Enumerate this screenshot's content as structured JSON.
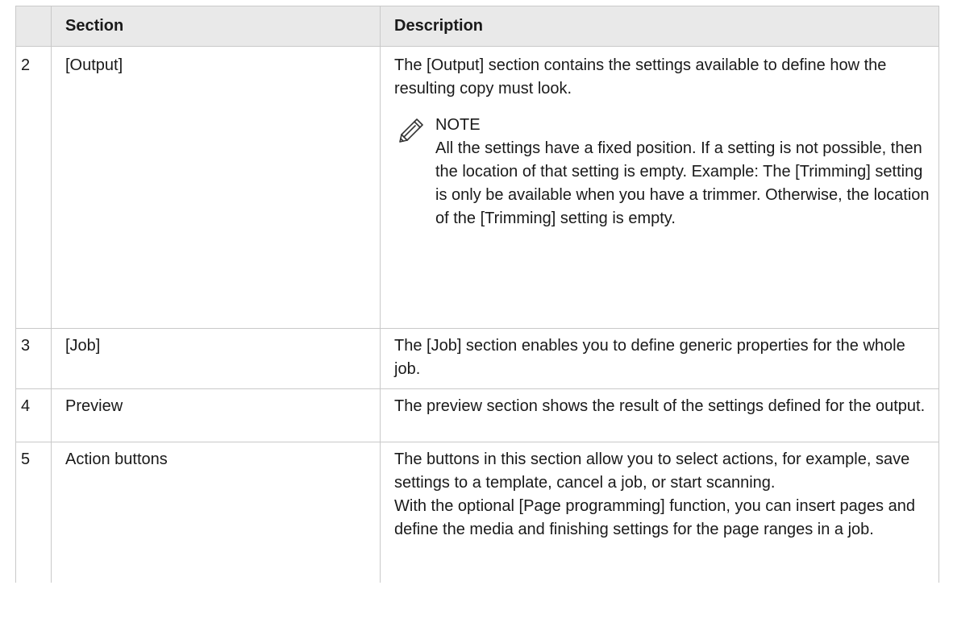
{
  "table": {
    "headers": {
      "number": "",
      "section": "Section",
      "description": "Description"
    },
    "rows": [
      {
        "number": "2",
        "section": "[Output]",
        "description": "The [Output] section contains the settings available to define how the resulting copy must look.",
        "note": {
          "icon": "pencil-icon",
          "title": "NOTE",
          "text": "All the settings have a fixed position. If a set­ting is not possible, then the location of that setting is empty. Example: The [Trimming] set­ting is only be available when you have a trim­mer. Otherwise, the location of the [Trimming] setting is empty."
        }
      },
      {
        "number": "3",
        "section": "[Job]",
        "description": "The [Job] section enables you to define generic proper­ties for the whole job."
      },
      {
        "number": "4",
        "section": "Preview",
        "description": "The preview section shows the result of the settings de­fined for the output."
      },
      {
        "number": "5",
        "section": "Action buttons",
        "description": "The buttons in this section allow you to select actions, for example, save settings to a template, cancel a job, or start scanning.",
        "description_2": "With the optional [Page programming] function, you can insert pages and define the media and finishing settings for the page ranges in a job."
      }
    ]
  }
}
